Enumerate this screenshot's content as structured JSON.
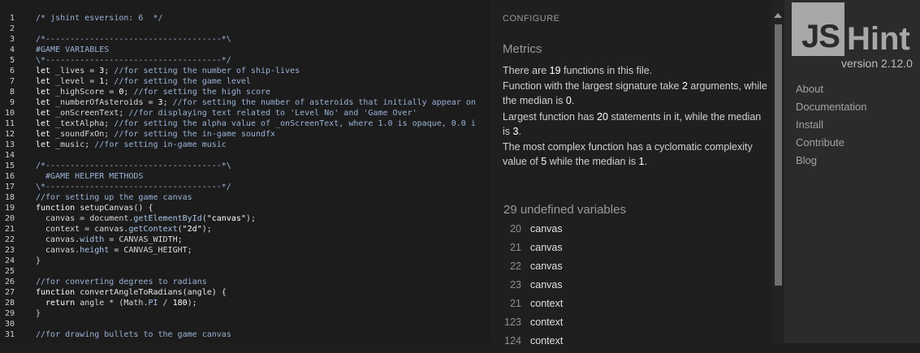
{
  "editor": {
    "lines": [
      {
        "n": "1",
        "tokens": [
          {
            "c": "c",
            "t": "/* jshint esversion: 6  */"
          }
        ]
      },
      {
        "n": "2",
        "tokens": []
      },
      {
        "n": "3",
        "tokens": [
          {
            "c": "c",
            "t": "/*------------------------------------*\\"
          }
        ]
      },
      {
        "n": "4",
        "tokens": [
          {
            "c": "c",
            "t": "#GAME VARIABLES"
          }
        ]
      },
      {
        "n": "5",
        "tokens": [
          {
            "c": "c",
            "t": "\\*------------------------------------*/"
          }
        ]
      },
      {
        "n": "6",
        "tokens": [
          {
            "c": "k",
            "t": "let "
          },
          {
            "c": "p",
            "t": "_lives = "
          },
          {
            "c": "n",
            "t": "3"
          },
          {
            "c": "p",
            "t": "; "
          },
          {
            "c": "c",
            "t": "//for setting the number of ship-lives"
          }
        ]
      },
      {
        "n": "7",
        "tokens": [
          {
            "c": "k",
            "t": "let "
          },
          {
            "c": "p",
            "t": "_level = "
          },
          {
            "c": "n",
            "t": "1"
          },
          {
            "c": "p",
            "t": "; "
          },
          {
            "c": "c",
            "t": "//for setting the game level"
          }
        ]
      },
      {
        "n": "8",
        "tokens": [
          {
            "c": "k",
            "t": "let "
          },
          {
            "c": "p",
            "t": "_highScore = "
          },
          {
            "c": "n",
            "t": "0"
          },
          {
            "c": "p",
            "t": "; "
          },
          {
            "c": "c",
            "t": "//for setting the high score"
          }
        ]
      },
      {
        "n": "9",
        "tokens": [
          {
            "c": "k",
            "t": "let "
          },
          {
            "c": "p",
            "t": "_numberOfAsteroids = "
          },
          {
            "c": "n",
            "t": "3"
          },
          {
            "c": "p",
            "t": "; "
          },
          {
            "c": "c",
            "t": "//for setting the number of asteroids that initially appear on"
          }
        ]
      },
      {
        "n": "10",
        "tokens": [
          {
            "c": "k",
            "t": "let "
          },
          {
            "c": "p",
            "t": "_onScreenText; "
          },
          {
            "c": "c",
            "t": "//for displaying text related to 'Level No' and 'Game Over'"
          }
        ]
      },
      {
        "n": "11",
        "tokens": [
          {
            "c": "k",
            "t": "let "
          },
          {
            "c": "p",
            "t": "_textAlpha; "
          },
          {
            "c": "c",
            "t": "//for setting the alpha value of _onScreenText, where 1.0 is opaque, 0.0 i"
          }
        ]
      },
      {
        "n": "12",
        "tokens": [
          {
            "c": "k",
            "t": "let "
          },
          {
            "c": "p",
            "t": "_soundFxOn; "
          },
          {
            "c": "c",
            "t": "//for setting the in-game soundfx"
          }
        ]
      },
      {
        "n": "13",
        "tokens": [
          {
            "c": "k",
            "t": "let "
          },
          {
            "c": "p",
            "t": "_music; "
          },
          {
            "c": "c",
            "t": "//for setting in-game music"
          }
        ]
      },
      {
        "n": "14",
        "tokens": []
      },
      {
        "n": "15",
        "tokens": [
          {
            "c": "c",
            "t": "/*------------------------------------*\\"
          }
        ]
      },
      {
        "n": "16",
        "tokens": [
          {
            "c": "c",
            "t": "  #GAME HELPER METHODS"
          }
        ]
      },
      {
        "n": "17",
        "tokens": [
          {
            "c": "c",
            "t": "\\*------------------------------------*/"
          }
        ]
      },
      {
        "n": "18",
        "tokens": [
          {
            "c": "c",
            "t": "//for setting up the game canvas"
          }
        ]
      },
      {
        "n": "19",
        "tokens": [
          {
            "c": "k",
            "t": "function "
          },
          {
            "c": "f",
            "t": "setupCanvas() {"
          }
        ]
      },
      {
        "n": "20",
        "tokens": [
          {
            "c": "p",
            "t": "  canvas = document."
          },
          {
            "c": "prop",
            "t": "getElementById"
          },
          {
            "c": "p",
            "t": "("
          },
          {
            "c": "s",
            "t": "\"canvas\""
          },
          {
            "c": "p",
            "t": ");"
          }
        ]
      },
      {
        "n": "21",
        "tokens": [
          {
            "c": "p",
            "t": "  context = canvas."
          },
          {
            "c": "prop",
            "t": "getContext"
          },
          {
            "c": "p",
            "t": "("
          },
          {
            "c": "s",
            "t": "\"2d\""
          },
          {
            "c": "p",
            "t": ");"
          }
        ]
      },
      {
        "n": "22",
        "tokens": [
          {
            "c": "p",
            "t": "  canvas."
          },
          {
            "c": "prop",
            "t": "width"
          },
          {
            "c": "p",
            "t": " = CANVAS_WIDTH;"
          }
        ]
      },
      {
        "n": "23",
        "tokens": [
          {
            "c": "p",
            "t": "  canvas."
          },
          {
            "c": "prop",
            "t": "height"
          },
          {
            "c": "p",
            "t": " = CANVAS_HEIGHT;"
          }
        ]
      },
      {
        "n": "24",
        "tokens": [
          {
            "c": "p",
            "t": "}"
          }
        ]
      },
      {
        "n": "25",
        "tokens": []
      },
      {
        "n": "26",
        "tokens": [
          {
            "c": "c",
            "t": "//for converting degrees to radians"
          }
        ]
      },
      {
        "n": "27",
        "tokens": [
          {
            "c": "k",
            "t": "function "
          },
          {
            "c": "f",
            "t": "convertAngleToRadians(angle) {"
          }
        ]
      },
      {
        "n": "28",
        "tokens": [
          {
            "c": "k",
            "t": "  return "
          },
          {
            "c": "p",
            "t": "angle * (Math."
          },
          {
            "c": "prop",
            "t": "PI"
          },
          {
            "c": "p",
            "t": " / "
          },
          {
            "c": "n",
            "t": "180"
          },
          {
            "c": "p",
            "t": ");"
          }
        ]
      },
      {
        "n": "29",
        "tokens": [
          {
            "c": "p",
            "t": "}"
          }
        ]
      },
      {
        "n": "30",
        "tokens": []
      },
      {
        "n": "31",
        "tokens": [
          {
            "c": "c",
            "t": "//for drawing bullets to the game canvas"
          }
        ]
      }
    ]
  },
  "report": {
    "configure": "CONFIGURE",
    "metrics_title": "Metrics",
    "metric_functions": {
      "pre": "There are ",
      "num": "19",
      "post": " functions in this file."
    },
    "metric_signature": {
      "pre": "Function with the largest signature take ",
      "num1": "2",
      "mid": " arguments, while the median is ",
      "num2": "0",
      "post": "."
    },
    "metric_statements": {
      "pre": "Largest function has ",
      "num1": "20",
      "mid": " statements in it, while the median is ",
      "num2": "3",
      "post": "."
    },
    "metric_complexity": {
      "pre": "The most complex function has a cyclomatic complexity value of ",
      "num1": "5",
      "mid": " while the median is ",
      "num2": "1",
      "post": "."
    },
    "undefined_title": "29 undefined variables",
    "undefined": [
      {
        "line": "20",
        "name": "canvas"
      },
      {
        "line": "21",
        "name": "canvas"
      },
      {
        "line": "22",
        "name": "canvas"
      },
      {
        "line": "23",
        "name": "canvas"
      },
      {
        "line": "21",
        "name": "context"
      },
      {
        "line": "123",
        "name": "context"
      },
      {
        "line": "124",
        "name": "context"
      }
    ]
  },
  "sidebar": {
    "logo_js": "JS",
    "logo_hint": "Hint",
    "version": "version 2.12.0",
    "nav": [
      "About",
      "Documentation",
      "Install",
      "Contribute",
      "Blog"
    ]
  }
}
